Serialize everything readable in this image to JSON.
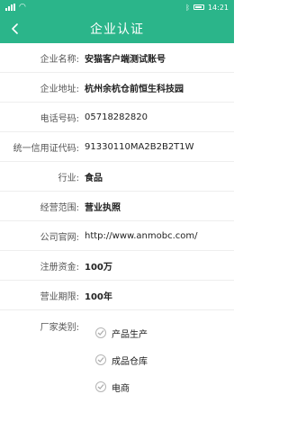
{
  "status_bar": {
    "time": "14:21",
    "battery_icon": "battery-icon",
    "signal_icon": "signal-icon"
  },
  "header": {
    "title": "企业认证",
    "back_icon": "chevron-left-icon"
  },
  "fields": [
    {
      "label": "企业名称:",
      "value": "安猫客户端测试账号",
      "bold": true
    },
    {
      "label": "企业地址:",
      "value": "杭州余杭仓前恒生科技园",
      "bold": true
    },
    {
      "label": "电话号码:",
      "value": "05718282820",
      "bold": false
    },
    {
      "label": "统一信用证代码:",
      "value": "91330110MA2B2B2T1W",
      "bold": false
    },
    {
      "label": "行业:",
      "value": "食品",
      "bold": true
    },
    {
      "label": "经营范围:",
      "value": "营业执照",
      "bold": true
    },
    {
      "label": "公司官网:",
      "value": "http://www.anmobc.com/",
      "bold": false
    },
    {
      "label": "注册资金:",
      "value": "100万",
      "bold": true
    },
    {
      "label": "营业期限:",
      "value": "100年",
      "bold": true
    }
  ],
  "factory_types": {
    "label": "厂家类别:",
    "options": [
      {
        "label": "产品生产",
        "checked": true
      },
      {
        "label": "成品仓库",
        "checked": true
      },
      {
        "label": "电商",
        "checked": true
      }
    ]
  },
  "colors": {
    "brand": "#2bb58a"
  }
}
